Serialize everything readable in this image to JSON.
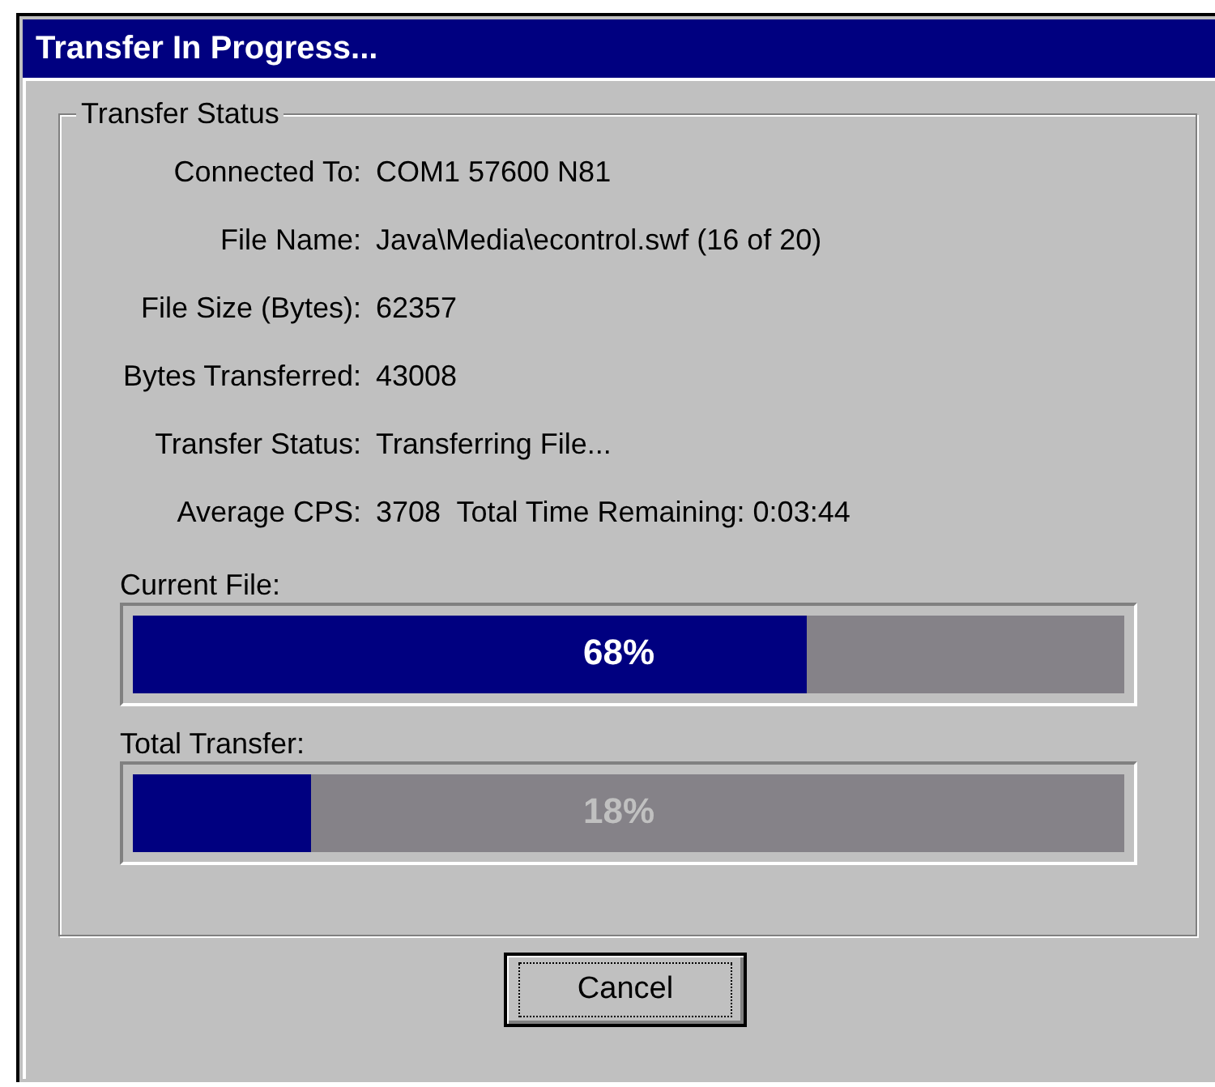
{
  "window": {
    "title": "Transfer In Progress..."
  },
  "group": {
    "title": "Transfer Status"
  },
  "fields": [
    {
      "label": "Connected To:",
      "value": "COM1 57600 N81"
    },
    {
      "label": "File Name:",
      "value": "Java\\Media\\econtrol.swf (16 of 20)"
    },
    {
      "label": "File Size (Bytes):",
      "value": "62357"
    },
    {
      "label": "Bytes Transferred:",
      "value": "43008"
    },
    {
      "label": "Transfer Status:",
      "value": "Transferring File..."
    },
    {
      "label": "Average CPS:",
      "value": "3708  Total Time Remaining: 0:03:44"
    }
  ],
  "progress": [
    {
      "label": "Current File:",
      "level": 0.68,
      "reading": "68%"
    },
    {
      "label": "Total Transfer:",
      "level": 0.18,
      "reading": "18%"
    }
  ],
  "buttons": [
    {
      "label": "Cancel"
    }
  ]
}
